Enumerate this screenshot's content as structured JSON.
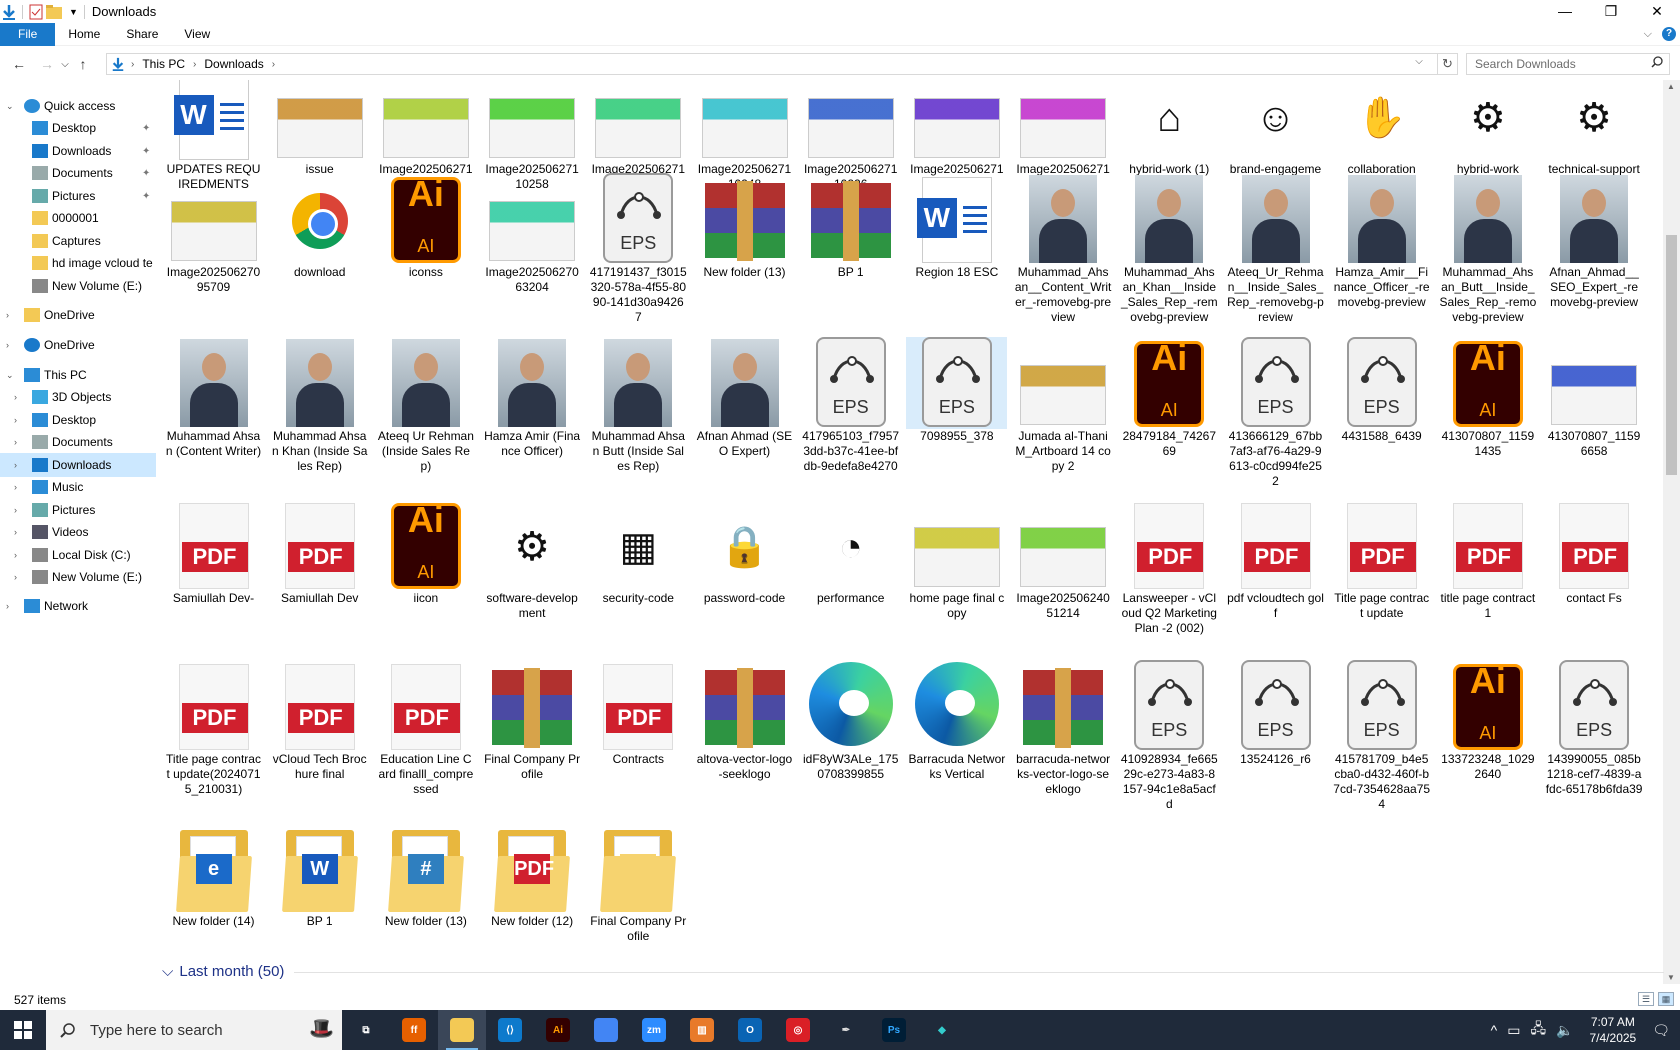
{
  "window": {
    "title": "Downloads",
    "controls": {
      "minimize": "—",
      "maximize": "❐",
      "close": "✕"
    }
  },
  "ribbon": {
    "tabs": [
      "File",
      "Home",
      "Share",
      "View"
    ],
    "expand": "⌵",
    "help": "?"
  },
  "address": {
    "back": "←",
    "forward": "→",
    "recent": "⌵",
    "up": "↑",
    "crumbs": [
      "This PC",
      "Downloads"
    ],
    "refresh": "↻",
    "search_placeholder": "Search Downloads"
  },
  "sidebar": {
    "items": [
      {
        "label": "Quick access",
        "icon": "star-icon",
        "level": 0,
        "expand": "⌄"
      },
      {
        "label": "Desktop",
        "icon": "desktop-folder-icon",
        "level": 1,
        "pinned": true
      },
      {
        "label": "Downloads",
        "icon": "download-arrow-icon",
        "level": 1,
        "pinned": true
      },
      {
        "label": "Documents",
        "icon": "documents-icon",
        "level": 1,
        "pinned": true
      },
      {
        "label": "Pictures",
        "icon": "pictures-icon",
        "level": 1,
        "pinned": true
      },
      {
        "label": "0000001",
        "icon": "folder-icon",
        "level": 1
      },
      {
        "label": "Captures",
        "icon": "folder-icon",
        "level": 1
      },
      {
        "label": "hd image vcloud te",
        "icon": "folder-icon",
        "level": 1
      },
      {
        "label": "New Volume (E:)",
        "icon": "drive-icon",
        "level": 1
      },
      {
        "label": "OneDrive",
        "icon": "folder-icon",
        "level": 0,
        "expand": "›"
      },
      {
        "label": "OneDrive",
        "icon": "cloud-icon",
        "level": 0,
        "expand": "›"
      },
      {
        "label": "This PC",
        "icon": "computer-icon",
        "level": 0,
        "expand": "⌄"
      },
      {
        "label": "3D Objects",
        "icon": "3d-objects-icon",
        "level": 1,
        "expand": "›"
      },
      {
        "label": "Desktop",
        "icon": "desktop-folder-icon",
        "level": 1,
        "expand": "›"
      },
      {
        "label": "Documents",
        "icon": "documents-icon",
        "level": 1,
        "expand": "›"
      },
      {
        "label": "Downloads",
        "icon": "download-arrow-icon",
        "level": 1,
        "expand": "›",
        "selected": true
      },
      {
        "label": "Music",
        "icon": "music-icon",
        "level": 1,
        "expand": "›"
      },
      {
        "label": "Pictures",
        "icon": "pictures-icon",
        "level": 1,
        "expand": "›"
      },
      {
        "label": "Videos",
        "icon": "videos-icon",
        "level": 1,
        "expand": "›"
      },
      {
        "label": "Local Disk (C:)",
        "icon": "drive-icon",
        "level": 1,
        "expand": "›"
      },
      {
        "label": "New Volume (E:)",
        "icon": "drive-icon",
        "level": 1,
        "expand": "›"
      },
      {
        "label": "Network",
        "icon": "network-icon",
        "level": 0,
        "expand": "›"
      }
    ],
    "pin_glyph": "📌"
  },
  "files": [
    [
      {
        "name": "UPDATES REQUIREDMENTS",
        "type": "word"
      },
      {
        "name": "issue",
        "type": "image"
      },
      {
        "name": "Image20250627114923",
        "type": "image"
      },
      {
        "name": "Image20250627110258",
        "type": "image"
      },
      {
        "name": "Image20250627110253",
        "type": "image"
      },
      {
        "name": "Image20250627110248",
        "type": "image"
      },
      {
        "name": "Image20250627110226",
        "type": "image"
      },
      {
        "name": "Image20250627110210",
        "type": "image"
      },
      {
        "name": "Image20250627110203",
        "type": "image"
      },
      {
        "name": "hybrid-work (1)",
        "type": "line-icon",
        "glyph": "⌂"
      },
      {
        "name": "brand-engagement",
        "type": "line-icon",
        "glyph": "☺"
      },
      {
        "name": "collaboration",
        "type": "line-icon",
        "glyph": "✋"
      },
      {
        "name": "hybrid-work",
        "type": "line-icon",
        "glyph": "⚙"
      },
      {
        "name": "technical-support",
        "type": "line-icon",
        "glyph": "⚙"
      }
    ],
    [
      {
        "name": "Image20250627095709",
        "type": "image"
      },
      {
        "name": "download",
        "type": "chrome"
      },
      {
        "name": "iconss",
        "type": "ai"
      },
      {
        "name": "Image20250627063204",
        "type": "image"
      },
      {
        "name": "417191437_f3015320-578a-4f55-8090-141d30a94267",
        "type": "eps"
      },
      {
        "name": "New folder (13)",
        "type": "rar"
      },
      {
        "name": "BP 1",
        "type": "rar"
      },
      {
        "name": "Region 18 ESC",
        "type": "word"
      },
      {
        "name": "Muhammad_Ahsan__Content_Writer_-removebg-preview",
        "type": "photo"
      },
      {
        "name": "Muhammad_Ahsan_Khan__Inside_Sales_Rep_-removebg-preview",
        "type": "photo"
      },
      {
        "name": "Ateeq_Ur_Rehman__Inside_Sales_Rep_-removebg-preview",
        "type": "photo"
      },
      {
        "name": "Hamza_Amir__Finance_Officer_-removebg-preview",
        "type": "photo"
      },
      {
        "name": "Muhammad_Ahsan_Butt__Inside_Sales_Rep_-removebg-preview",
        "type": "photo"
      },
      {
        "name": "Afnan_Ahmad__SEO_Expert_-removebg-preview",
        "type": "photo"
      }
    ],
    [
      {
        "name": "Muhammad Ahsan (Content Writer)",
        "type": "photo"
      },
      {
        "name": "Muhammad Ahsan Khan (Inside Sales Rep)",
        "type": "photo"
      },
      {
        "name": "Ateeq Ur Rehman (Inside Sales Rep)",
        "type": "photo"
      },
      {
        "name": "Hamza Amir (Finance Officer)",
        "type": "photo"
      },
      {
        "name": "Muhammad Ahsan Butt (Inside Sales Rep)",
        "type": "photo"
      },
      {
        "name": "Afnan Ahmad (SEO Expert)",
        "type": "photo"
      },
      {
        "name": "417965103_f79573dd-b37c-41ee-bfdb-9edefa8e4270",
        "type": "eps"
      },
      {
        "name": "7098955_378",
        "type": "eps",
        "selected": true
      },
      {
        "name": "Jumada al-Thani M_Artboard 14 copy 2",
        "type": "image"
      },
      {
        "name": "28479184_7426769",
        "type": "ai"
      },
      {
        "name": "413666129_67bb7af3-af76-4a29-9613-c0cd994fe252",
        "type": "eps"
      },
      {
        "name": "4431588_6439",
        "type": "eps"
      },
      {
        "name": "413070807_11591435",
        "type": "ai"
      },
      {
        "name": "413070807_11596658",
        "type": "image"
      }
    ],
    [
      {
        "name": "Samiullah Dev-",
        "type": "pdf"
      },
      {
        "name": "Samiullah Dev",
        "type": "pdf"
      },
      {
        "name": "iicon",
        "type": "ai"
      },
      {
        "name": "software-development",
        "type": "line-icon",
        "glyph": "⚙"
      },
      {
        "name": "security-code",
        "type": "line-icon",
        "glyph": "▦"
      },
      {
        "name": "password-code",
        "type": "line-icon",
        "glyph": "🔒"
      },
      {
        "name": "performance",
        "type": "line-icon",
        "glyph": "◔"
      },
      {
        "name": "home page final copy",
        "type": "image"
      },
      {
        "name": "Image20250624051214",
        "type": "image"
      },
      {
        "name": "Lansweeper - vCloud Q2 Marketing Plan -2 (002)",
        "type": "pdf"
      },
      {
        "name": "pdf vcloudtech golf",
        "type": "pdf"
      },
      {
        "name": "Title page contract  update",
        "type": "pdf"
      },
      {
        "name": "title page contract 1",
        "type": "pdf"
      },
      {
        "name": "contact Fs",
        "type": "pdf"
      }
    ],
    [
      {
        "name": "Title page contract update(20240715_210031)",
        "type": "pdf"
      },
      {
        "name": "vCloud Tech Brochure final",
        "type": "pdf"
      },
      {
        "name": "Education Line Card finalll_compressed",
        "type": "pdf"
      },
      {
        "name": "Final Company Profile",
        "type": "rar"
      },
      {
        "name": "Contracts",
        "type": "pdf"
      },
      {
        "name": "altova-vector-logo-seeklogo",
        "type": "rar"
      },
      {
        "name": "idF8yW3ALe_1750708399855",
        "type": "edge"
      },
      {
        "name": "Barracuda Networks Vertical",
        "type": "edge"
      },
      {
        "name": "barracuda-networks-vector-logo-seeklogo",
        "type": "rar"
      },
      {
        "name": "410928934_fe66529c-e273-4a83-8157-94c1e8a5acfd",
        "type": "eps"
      },
      {
        "name": "13524126_r6",
        "type": "eps"
      },
      {
        "name": "415781709_b4e5cba0-d432-460f-b7cd-7354628aa754",
        "type": "eps"
      },
      {
        "name": "133723248_10292640",
        "type": "ai"
      },
      {
        "name": "143990055_085b1218-cef7-4839-afdc-65178b6fda39",
        "type": "eps"
      }
    ],
    [
      {
        "name": "New folder (14)",
        "type": "folder",
        "glyph": "e",
        "gcolor": "#1b6ac9"
      },
      {
        "name": "BP 1",
        "type": "folder",
        "glyph": "W",
        "gcolor": "#185abd"
      },
      {
        "name": "New folder (13)",
        "type": "folder",
        "glyph": "#",
        "gcolor": "#2f7fbf"
      },
      {
        "name": "New folder (12)",
        "type": "folder",
        "glyph": "PDF",
        "gcolor": "#d0202e"
      },
      {
        "name": "Final Company Profile",
        "type": "folder",
        "glyph": "",
        "gcolor": "#f6d36f"
      }
    ]
  ],
  "icon_labels": {
    "pdf": "PDF",
    "eps": "EPS",
    "ai_big": "Ai",
    "ai_small": "AI",
    "word": "W"
  },
  "group_header": {
    "label": "Last month (50)",
    "chevron": "⌵"
  },
  "status": {
    "items": "527 items"
  },
  "taskbar": {
    "search_placeholder": "Type here to search",
    "apps": [
      {
        "name": "task-view-icon",
        "label": "⧉",
        "bg": "transparent",
        "fg": "#fff"
      },
      {
        "name": "firefox-icon",
        "label": "ff",
        "bg": "#e66000",
        "fg": "#fff"
      },
      {
        "name": "file-explorer-icon",
        "label": "",
        "bg": "#f3c955",
        "fg": "#000",
        "active": true
      },
      {
        "name": "vscode-icon",
        "label": "⟨⟩",
        "bg": "#0d7acc",
        "fg": "#fff"
      },
      {
        "name": "illustrator-icon",
        "label": "Ai",
        "bg": "#330000",
        "fg": "#ff9a00"
      },
      {
        "name": "chrome-icon",
        "label": "",
        "bg": "#4285f4",
        "fg": "#fff"
      },
      {
        "name": "zoom-icon",
        "label": "zm",
        "bg": "#2d8cff",
        "fg": "#fff"
      },
      {
        "name": "winrar-icon",
        "label": "▥",
        "bg": "#e87a2a",
        "fg": "#fff"
      },
      {
        "name": "outlook-icon",
        "label": "O",
        "bg": "#0a64b4",
        "fg": "#fff"
      },
      {
        "name": "creative-cloud-icon",
        "label": "◎",
        "bg": "#da1f26",
        "fg": "#fff"
      },
      {
        "name": "pen-tool-icon",
        "label": "✒",
        "bg": "transparent",
        "fg": "#ddd"
      },
      {
        "name": "photoshop-icon",
        "label": "Ps",
        "bg": "#001e36",
        "fg": "#31a8ff"
      },
      {
        "name": "app-diamond-icon",
        "label": "◆",
        "bg": "transparent",
        "fg": "#3cc"
      }
    ],
    "tray": {
      "chevron": "^",
      "time": "7:07 AM",
      "date": "7/4/2025"
    }
  }
}
